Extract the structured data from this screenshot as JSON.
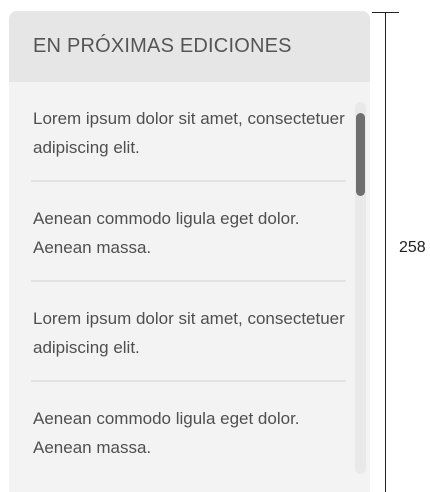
{
  "panel": {
    "title": "EN PRÓXIMAS EDICIONES",
    "items": [
      {
        "text": "Lorem ipsum dolor sit amet, consectetuer adipiscing elit."
      },
      {
        "text": "Aenean commodo ligula eget dolor. Aenean massa."
      },
      {
        "text": "Lorem ipsum dolor sit amet, consectetuer adipiscing elit."
      },
      {
        "text": "Aenean commodo ligula eget dolor. Aenean massa."
      }
    ]
  },
  "dimension": {
    "label": "258"
  }
}
